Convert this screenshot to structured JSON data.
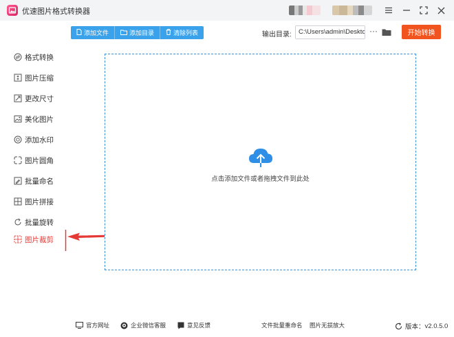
{
  "window": {
    "title": "优速图片格式转换器",
    "controls": [
      "menu-icon",
      "minimize-icon",
      "maximize-icon",
      "close-icon"
    ]
  },
  "toolbar": {
    "add_file": "添加文件",
    "add_dir": "添加目录",
    "clear_list": "清除列表",
    "output_label": "输出目录:",
    "output_path": "C:\\Users\\admin\\Deskto",
    "more_label": "···",
    "start_label": "开始转换"
  },
  "sidebar": {
    "items": [
      {
        "label": "格式转换",
        "icon": "format-convert-icon"
      },
      {
        "label": "图片压缩",
        "icon": "compress-icon"
      },
      {
        "label": "更改尺寸",
        "icon": "resize-icon"
      },
      {
        "label": "美化图片",
        "icon": "beautify-icon"
      },
      {
        "label": "添加水印",
        "icon": "watermark-icon"
      },
      {
        "label": "图片圆角",
        "icon": "round-corner-icon"
      },
      {
        "label": "批量命名",
        "icon": "rename-icon"
      },
      {
        "label": "图片拼接",
        "icon": "stitch-icon"
      },
      {
        "label": "批量旋转",
        "icon": "rotate-icon"
      },
      {
        "label": "图片裁剪",
        "icon": "crop-icon"
      }
    ],
    "active_index": 9
  },
  "dropzone": {
    "text": "点击添加文件或者拖拽文件到此处"
  },
  "footer": {
    "website": "官方网址",
    "wechat": "企业微信客服",
    "feedback": "意见反馈",
    "batch_rename": "文件批量重命名",
    "lossless_zoom": "图片无损放大",
    "version_label": "版本：",
    "version": "v2.0.5.0"
  },
  "colors": {
    "accent_blue": "#3aa2ea",
    "start_orange": "#f2541f",
    "active_red": "#e53935",
    "dropzone_border": "#3a8fd6"
  }
}
